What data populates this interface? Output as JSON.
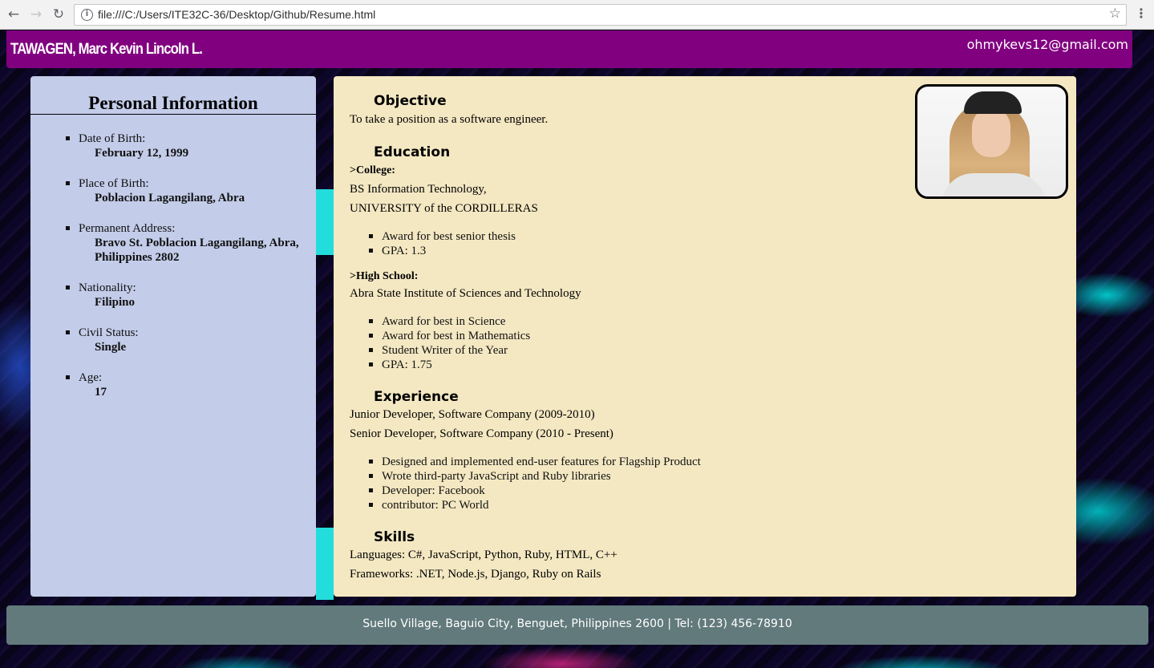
{
  "browser": {
    "url": "file:///C:/Users/ITE32C-36/Desktop/Github/Resume.html",
    "back_icon": "arrow-left",
    "forward_icon": "arrow-right",
    "reload_icon": "reload",
    "info_icon": "info",
    "bookmark_icon": "star",
    "menu_icon": "vertical-dots"
  },
  "header": {
    "name": "TAWAGEN, Marc Kevin Lincoln L.",
    "email": "ohmykevs12@gmail.com"
  },
  "personal": {
    "title": "Personal Information",
    "items": [
      {
        "label": "Date of Birth:",
        "value": "February 12, 1999"
      },
      {
        "label": "Place of Birth:",
        "value": "Poblacion Lagangilang, Abra"
      },
      {
        "label": "Permanent Address:",
        "value": "Bravo St. Poblacion Lagangilang, Abra, Philippines 2802"
      },
      {
        "label": "Nationality:",
        "value": "Filipino"
      },
      {
        "label": "Civil Status:",
        "value": "Single"
      },
      {
        "label": "Age:",
        "value": "17"
      }
    ]
  },
  "objective": {
    "heading": "Objective",
    "text": "To take a position as a software engineer."
  },
  "education": {
    "heading": "Education",
    "college": {
      "label": ">College:",
      "degree": "BS Information Technology,",
      "school": "UNIVERSITY of the CORDILLERAS",
      "bullets": [
        "Award for best senior thesis",
        "GPA: 1.3"
      ]
    },
    "highschool": {
      "label": ">High School:",
      "school": "Abra State Institute of Sciences and Technology",
      "bullets": [
        "Award for best in Science",
        "Award for best in Mathematics",
        "Student Writer of the Year",
        "GPA: 1.75"
      ]
    }
  },
  "experience": {
    "heading": "Experience",
    "lines": [
      "Junior Developer, Software Company (2009-2010)",
      "Senior Developer, Software Company (2010 - Present)"
    ],
    "bullets": [
      "Designed and implemented end-user features for Flagship Product",
      "Wrote third-party JavaScript and Ruby libraries",
      "Developer: Facebook",
      "contributor: PC World"
    ]
  },
  "skills": {
    "heading": "Skills",
    "languages": "Languages: C#, JavaScript, Python, Ruby, HTML, C++",
    "frameworks": "Frameworks: .NET, Node.js, Django, Ruby on Rails"
  },
  "footer": {
    "text": "Suello Village, Baguio City, Benguet, Philippines 2600 | Tel: (123) 456-78910"
  },
  "colors": {
    "header_bg": "#800080",
    "left_panel_bg": "#c3cce8",
    "main_panel_bg": "#f4e8c3",
    "footer_bg": "#637a7d",
    "accent_cyan": "#23dcdc"
  }
}
